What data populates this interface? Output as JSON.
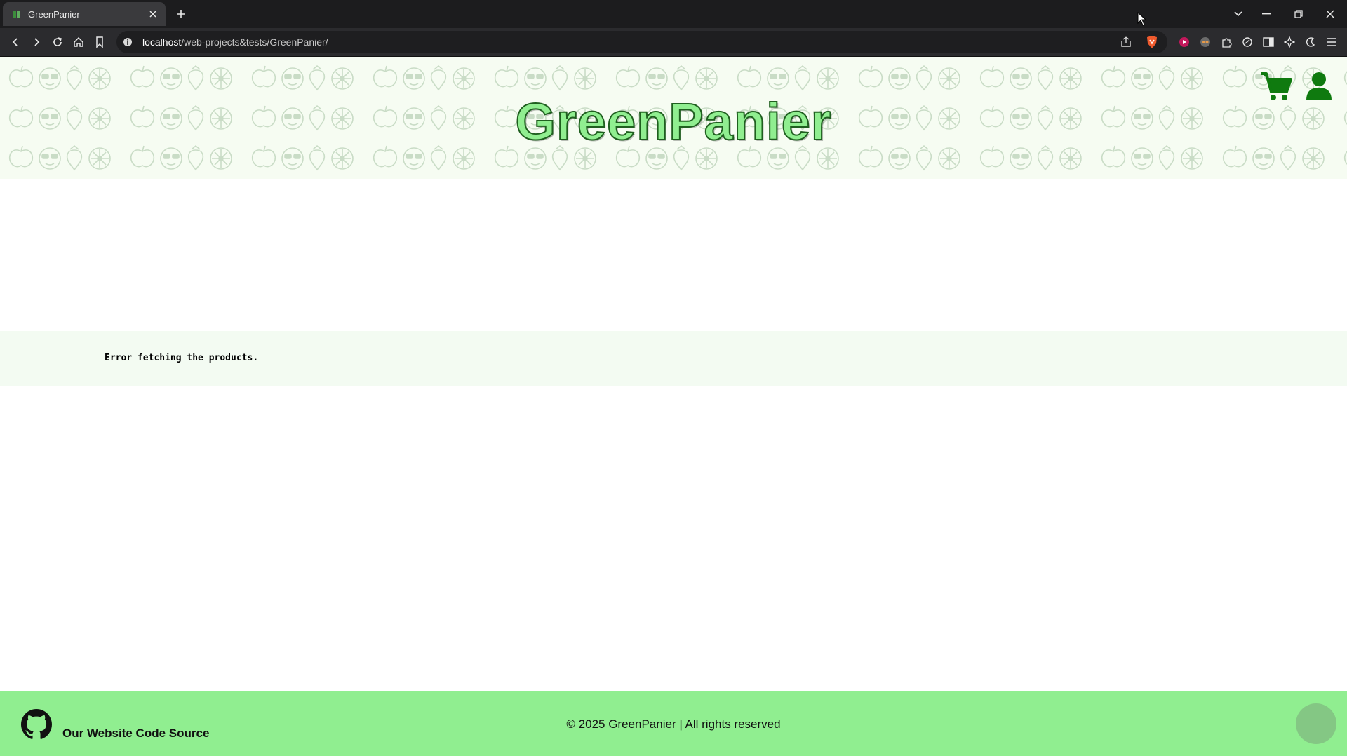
{
  "browser": {
    "tab_title": "GreenPanier",
    "url_host": "localhost",
    "url_path": "/web-projects&tests/GreenPanier/"
  },
  "header": {
    "logo": "GreenPanier",
    "accent": "#90ee90",
    "icon_color": "#0f7a0f"
  },
  "main": {
    "error_message": "Error fetching the products."
  },
  "footer": {
    "source_link": "Our Website Code Source",
    "copyright": "© 2025 GreenPanier | All rights reserved",
    "background": "#90ee90"
  },
  "icons": [
    "back-icon",
    "forward-icon",
    "reload-icon",
    "home-icon",
    "bookmark-icon",
    "info-icon",
    "share-icon",
    "brave-shield-icon",
    "cart-icon",
    "user-icon",
    "github-icon"
  ]
}
